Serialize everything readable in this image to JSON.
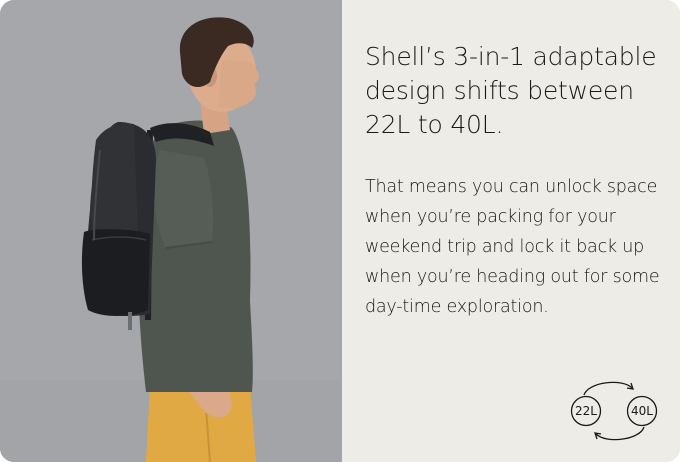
{
  "panel": {
    "headline": "Shell’s 3-in-1 adaptable design shifts between 22L to 40L.",
    "body": "That means you can unlock space when you’re packing for your weekend trip and lock it back up when you’re heading out for some day-time exploration."
  },
  "capacity_icon": {
    "small_label": "22L",
    "large_label": "40L",
    "icon_name": "capacity-cycle-icon"
  },
  "photo": {
    "subject": "man-wearing-black-backpack"
  },
  "colors": {
    "panel_bg": "#eeece6",
    "photo_bg": "#a6a8ab",
    "text": "#1a1a1a"
  }
}
